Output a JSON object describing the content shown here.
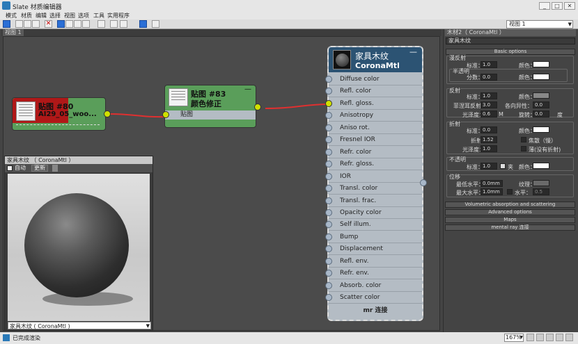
{
  "app": {
    "title": "Slate 材质编辑器"
  },
  "window_buttons": [
    "_",
    "□",
    "✕"
  ],
  "menu": [
    "模式",
    "材质",
    "编辑",
    "选择",
    "视图",
    "选项",
    "工具",
    "实用程序"
  ],
  "view_select": "视图 1",
  "tab": "视图 1",
  "nodes": {
    "n80": {
      "title": "贴图 #80",
      "subtitle": "AI29_05_woo..."
    },
    "n83": {
      "title": "贴图 #83",
      "subtitle": "颜色修正",
      "input": "贴图"
    },
    "mtl": {
      "title": "家具木纹",
      "subtitle": "CoronaMtl",
      "minimize": "—",
      "footer": "mr 连接",
      "slots": [
        "Diffuse color",
        "Refl. color",
        "Refl. gloss.",
        "Anisotropy",
        "Aniso rot.",
        "Fresnel IOR",
        "Refr. color",
        "Refr. gloss.",
        "IOR",
        "Transl. color",
        "Transl. frac.",
        "Opacity color",
        "Self illum.",
        "Bump",
        "Displacement",
        "Refl. env.",
        "Refr. env.",
        "Absorb. color",
        "Scatter color"
      ]
    }
  },
  "preview": {
    "title": "家具木纹 （ CoronaMtl ）",
    "auto_label": "自动",
    "update_label": "更新",
    "selected": "家具木纹 ( CoronaMtl )"
  },
  "right_panel": {
    "header": "木材2（ CoronaMtl ）",
    "name_field": "家具木纹",
    "rollout": "Basic options",
    "diffuse": {
      "title": "漫反射",
      "level_label": "标准：",
      "level": "1.0",
      "color_label": "颜色：",
      "translucency": {
        "title": "半透明",
        "fraction_label": "分数：",
        "fraction": "0.0",
        "color_label": "颜色："
      }
    },
    "reflection": {
      "title": "反射",
      "level_label": "标准：",
      "level": "1.0",
      "color_label": "颜色：",
      "fresnel_label": "菲涅耳反射",
      "fresnel": "3.0",
      "aniso_label": "各向异性：",
      "aniso": "0.0",
      "gloss_label": "光泽度：",
      "gloss": "0.6",
      "m_label": "M",
      "rot_label": "旋转：",
      "rot": "0.0",
      "deg": "度"
    },
    "refraction": {
      "title": "折射",
      "level_label": "标准：",
      "level": "0.0",
      "color_label": "颜色：",
      "ior_label": "折射",
      "ior": "1.52",
      "caustics": "焦散（慢）",
      "gloss_label": "光泽度：",
      "gloss": "1.0",
      "thin": "薄(没有折射)"
    },
    "opacity": {
      "title": "不透明",
      "level_label": "标准：",
      "level": "1.0",
      "clip": "夹",
      "color_label": "颜色："
    },
    "displacement": {
      "title": "位移",
      "min_label": "最低水平：",
      "min": "0.0mm",
      "max_label": "最大水平：",
      "max": "1.0mm",
      "tex_label": "纹理：",
      "water_label": "水平：",
      "water": "0.5"
    },
    "rollouts": [
      "Volumetric absorption and scattering",
      "Advanced options",
      "Maps",
      "mental ray 连接"
    ]
  },
  "status": {
    "text": "已完成渲染",
    "zoom": "167%"
  },
  "colors": {
    "node_green": "#5a9e5a",
    "mtl_header": "#2c5373",
    "selected_red": "#b01818",
    "wire": "#e03030",
    "socket": "#d0e000"
  }
}
